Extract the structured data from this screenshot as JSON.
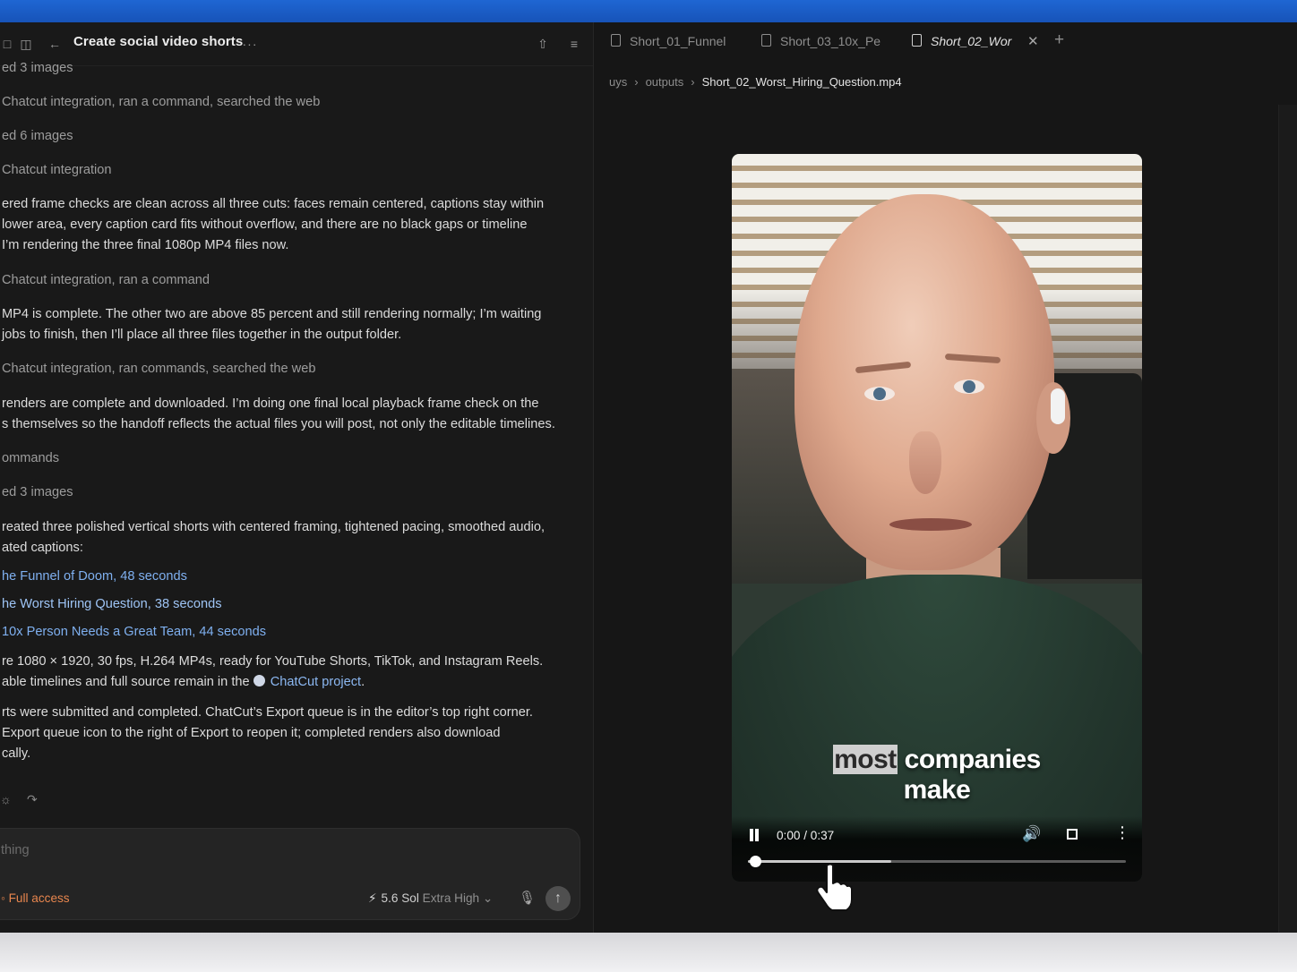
{
  "header": {
    "title": "Create social video shorts"
  },
  "messages": [
    {
      "text": "ed 3 images",
      "style": "muted",
      "top": 0
    },
    {
      "text": "Chatcut integration, ran a command, searched the web",
      "style": "muted",
      "top": 0
    },
    {
      "text": "ed 6 images",
      "style": "muted",
      "top": 0
    },
    {
      "text": "Chatcut integration",
      "style": "muted",
      "top": 0
    },
    {
      "text": "ered frame checks are clean across all three cuts: faces remain centered, captions stay within",
      "style": "body",
      "top": 0
    },
    {
      "text": "lower area, every caption card fits without overflow, and there are no black gaps or timeline",
      "style": "body",
      "top": 0
    },
    {
      "text": " I’m rendering the three final 1080p MP4 files now.",
      "style": "body",
      "top": 0
    },
    {
      "text": "Chatcut integration, ran a command",
      "style": "muted",
      "top": 0
    },
    {
      "text": "MP4 is complete. The other two are above 85 percent and still rendering normally; I’m waiting",
      "style": "body",
      "top": 0
    },
    {
      "text": " jobs to finish, then I’ll place all three files together in the output folder.",
      "style": "body",
      "top": 0
    },
    {
      "text": "Chatcut integration, ran commands, searched the web",
      "style": "muted",
      "top": 0
    },
    {
      "text": "renders are complete and downloaded. I’m doing one final local playback frame check on the",
      "style": "body",
      "top": 0
    },
    {
      "text": "s themselves so the handoff reflects the actual files you will post, not only the editable timelines.",
      "style": "body",
      "top": 0
    },
    {
      "text": "ommands",
      "style": "muted",
      "top": 0
    },
    {
      "text": "ed 3 images",
      "style": "muted",
      "top": 0
    },
    {
      "text": "reated three polished vertical shorts with centered framing, tightened pacing, smoothed audio,",
      "style": "body",
      "top": 0
    },
    {
      "text": "ated captions:",
      "style": "body",
      "top": 0
    },
    {
      "text": "he Funnel of Doom, 48 seconds",
      "style": "link",
      "top": 0
    },
    {
      "text": "he Worst Hiring Question, 38 seconds",
      "style": "link2",
      "top": 0
    },
    {
      "text": "10x Person Needs a Great Team, 44 seconds",
      "style": "link",
      "top": 0
    },
    {
      "text": "re 1080 × 1920, 30 fps, H.264 MP4s, ready for YouTube Shorts, TikTok, and Instagram Reels.",
      "style": "body",
      "top": 0
    },
    {
      "text": "rts were submitted and completed. ChatCut’s Export queue is in the editor’s top right corner.",
      "style": "body",
      "top": 0
    },
    {
      "text": " Export queue icon to the right of Export to reopen it; completed renders also download",
      "style": "body",
      "top": 0
    },
    {
      "text": "cally.",
      "style": "body",
      "top": 0
    }
  ],
  "project_line": {
    "prefix": "able timelines and full source remain in the ",
    "link": "ChatCut project",
    "suffix": "."
  },
  "composer": {
    "placeholder": "thing",
    "access": "Full access",
    "model": "5.6 Sol",
    "effort": "Extra High"
  },
  "tabs": [
    {
      "label": "Short_01_Funnel",
      "active": false
    },
    {
      "label": "Short_03_10x_Pe",
      "active": false
    },
    {
      "label": "Short_02_Wor",
      "active": true
    }
  ],
  "breadcrumb": {
    "root": "uys",
    "folder": "outputs",
    "file": "Short_02_Worst_Hiring_Question.mp4"
  },
  "video": {
    "caption_highlight": "most",
    "caption_rest": " companies",
    "caption_line2": "make",
    "time": "0:00 / 0:37",
    "progress": 0.02,
    "buffered": 0.38
  },
  "colors": {
    "accent_blue": "#7fb0f0",
    "access_orange": "#e8864e",
    "titlebar_blue": "#1f66d3"
  }
}
